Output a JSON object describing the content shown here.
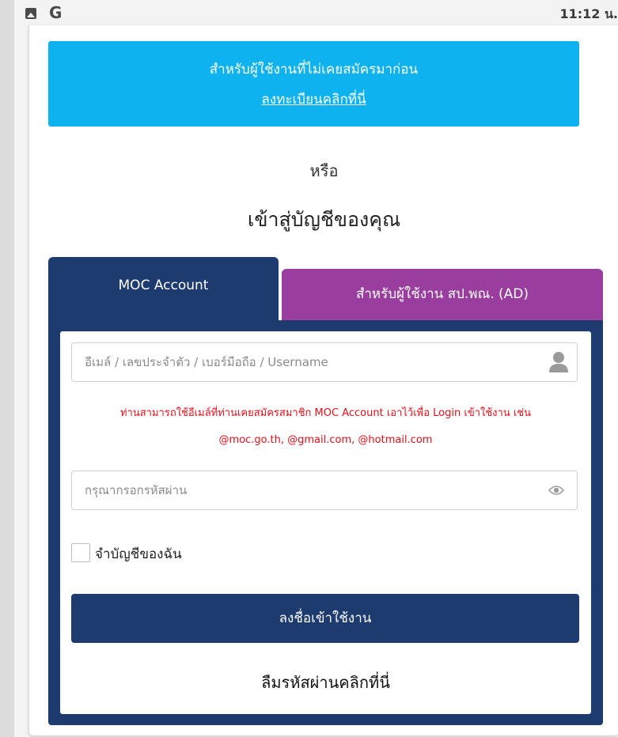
{
  "status_bar": {
    "app_letter": "G",
    "time": "11:12 น."
  },
  "register_banner": {
    "text": "สำหรับผู้ใช้งานที่ไม่เคยสมัครมาก่อน",
    "link": "ลงทะเบียนคลิกที่นี่"
  },
  "or_text": "หรือ",
  "heading": "เข้าสู่บัญชีของคุณ",
  "tabs": {
    "moc": "MOC Account",
    "ad": "สำหรับผู้ใช้งาน สป.พณ. (AD)"
  },
  "form": {
    "username_placeholder": "อีเมล์ / เลขประจำตัว / เบอร์มือถือ / Username",
    "hint_line1": "ท่านสามารถใช้อีเมล์ที่ท่านเคยสมัครสมาชิก MOC Account เอาไว้เพื่อ Login เข้าใช้งาน เช่น",
    "hint_line2": "@moc.go.th, @gmail.com, @hotmail.com",
    "password_placeholder": "กรุณากรอกรหัสผ่าน",
    "remember_label": "จำบัญชีของฉัน",
    "login_button": "ลงชื่อเข้าใช้งาน",
    "forgot_link": "ลืมรหัสผ่านคลิกที่นี่"
  },
  "colors": {
    "banner": "#0db2ee",
    "primary_navy": "#1e3b70",
    "ad_tab_purple": "#993d9e",
    "hint_red": "#e0101a"
  }
}
